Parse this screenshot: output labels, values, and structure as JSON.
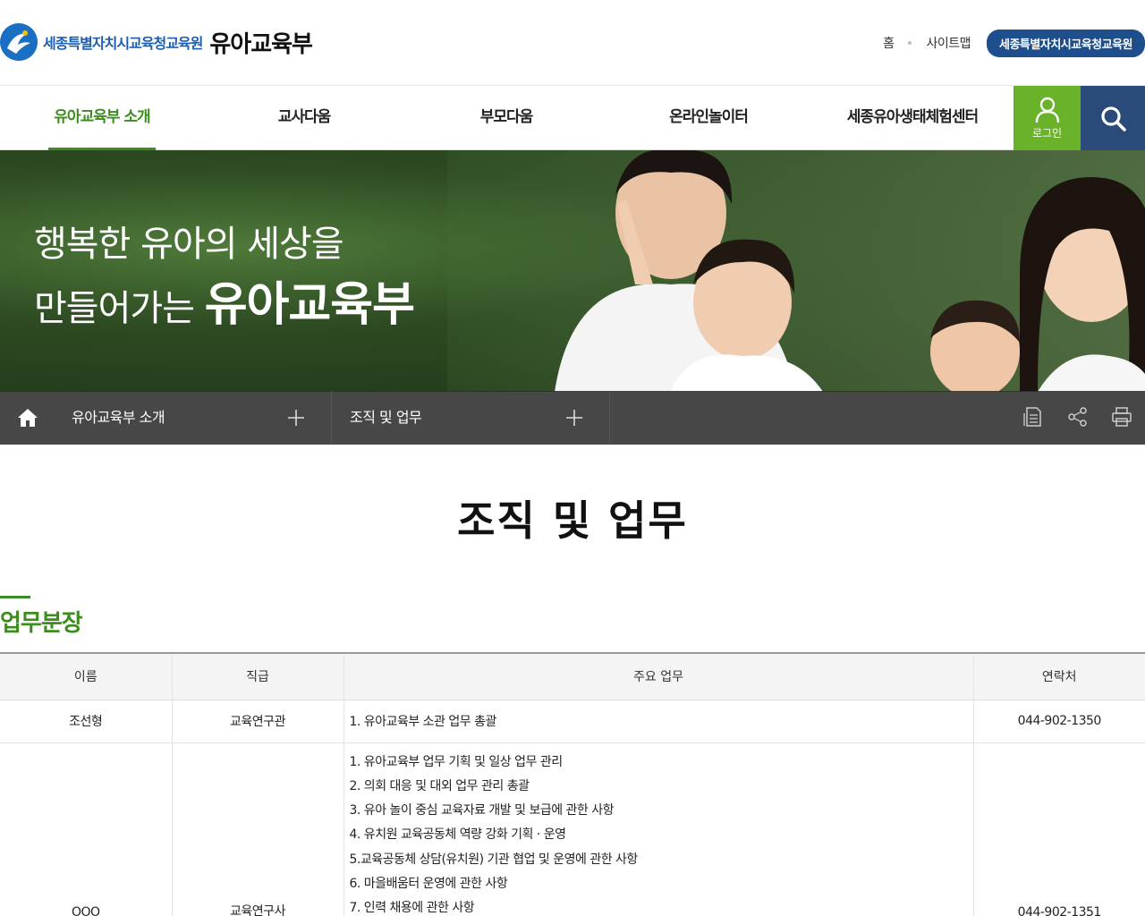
{
  "header": {
    "org_name": "세종특별자치시교육청교육원",
    "dept_name": "유아교육부",
    "util_links": [
      "홈",
      "사이트맵"
    ],
    "util_button": "세종특별자치시교육청교육원"
  },
  "gnb": {
    "items": [
      "유아교육부 소개",
      "교사다움",
      "부모다움",
      "온라인놀이터",
      "세종유아생태체험센터"
    ],
    "login_label": "로그인"
  },
  "banner": {
    "line1": "행복한 유아의 세상을",
    "line2_prefix": "만들어가는",
    "line2_strong": "유아교육부"
  },
  "location": {
    "depth1": "유아교육부 소개",
    "depth2": "조직 및 업무"
  },
  "content": {
    "page_title": "조직 및 업무",
    "section_title": "업무분장",
    "table": {
      "headers": [
        "이름",
        "직급",
        "주요 업무",
        "연락처"
      ],
      "rows": [
        {
          "name": "조선형",
          "rank": "교육연구관",
          "duties": [
            "1. 유아교육부 소관 업무 총괄"
          ],
          "phone": "044-902-1350"
        },
        {
          "name": "OOO",
          "rank": "교육연구사",
          "duties": [
            "1. 유아교육부 업무 기획 및 일상 업무 관리",
            "2. 의회 대응 및 대외 업무 관리 총괄",
            "3. 유아 놀이 중심 교육자료 개발 및 보급에 관한 사항",
            "4. 유치원 교육공동체 역량 강화 기획 · 운영",
            "5.교육공동체 상담(유치원) 기관 협업 및 운영에 관한 사항",
            "6. 마을배움터 운영에 관한 사항",
            "7. 인력 채용에 관한 사항"
          ],
          "phone": "044-902-1351"
        }
      ]
    }
  },
  "colors": {
    "accent_green": "#3d8c1e",
    "login_green": "#6ab22a",
    "navy": "#1f4e8c",
    "search_navy": "#2a4a7a"
  }
}
